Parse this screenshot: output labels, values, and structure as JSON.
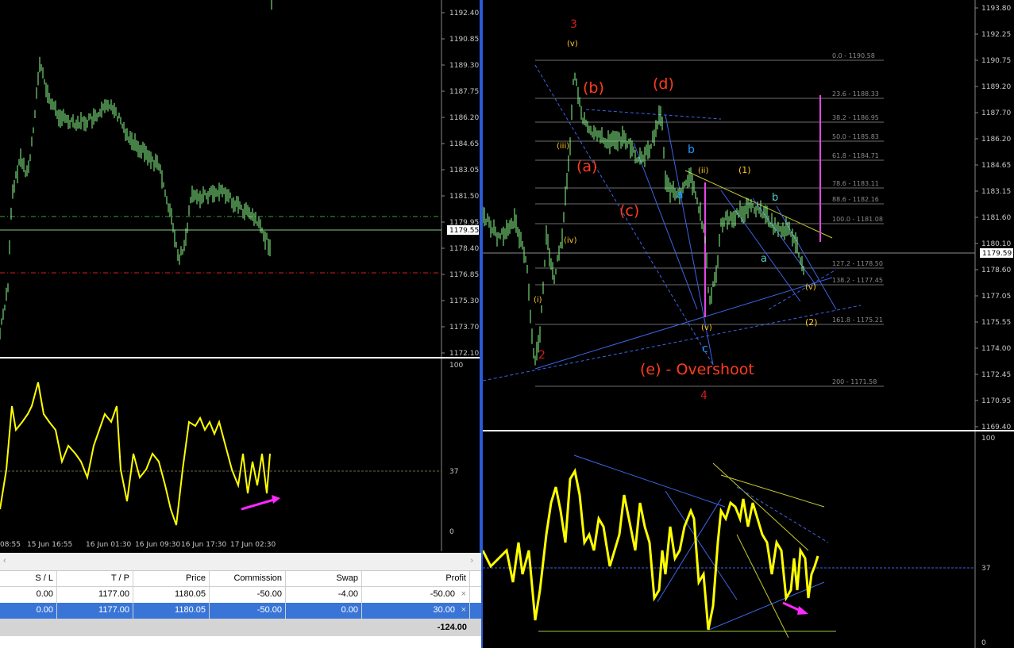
{
  "left_chart": {
    "price_labels": [
      "1192.40",
      "1190.85",
      "1189.30",
      "1187.75",
      "1186.20",
      "1184.65",
      "1183.05",
      "1181.50",
      "1179.95",
      "1178.40",
      "1176.85",
      "1175.30",
      "1173.70",
      "1172.10"
    ],
    "current_price": "1179.55",
    "indicator_labels": [
      "100",
      "37",
      "0"
    ],
    "time_labels": [
      "08:55",
      "15 Jun 16:55",
      "16 Jun 01:30",
      "16 Jun 09:30",
      "16 Jun 17:30",
      "17 Jun 02:30"
    ]
  },
  "right_chart": {
    "price_labels": [
      "1193.80",
      "1192.25",
      "1190.75",
      "1189.20",
      "1187.70",
      "1186.20",
      "1184.65",
      "1183.15",
      "1181.60",
      "1180.10",
      "1178.60",
      "1177.05",
      "1175.55",
      "1174.00",
      "1172.45",
      "1170.95",
      "1169.40"
    ],
    "current_price": "1179.59",
    "indicator_labels": [
      "100",
      "37",
      "0"
    ],
    "fib_labels": [
      "0.0 - 1190.58",
      "23.6 - 1188.33",
      "38.2 - 1186.95",
      "50.0 - 1185.83",
      "61.8 - 1184.71",
      "78.6 - 1183.11",
      "88.6 - 1182.16",
      "100.0 - 1181.08",
      "127.2 - 1178.50",
      "138.2 - 1177.45",
      "161.8 - 1175.21",
      "200 - 1171.58"
    ],
    "wave_labels": {
      "w3": "3",
      "w4": "4",
      "w2": "2",
      "a": "(a)",
      "b": "(b)",
      "c": "(c)",
      "d": "(d)",
      "e": "(e) - Overshoot",
      "sa": "a",
      "sb": "b",
      "sc": "c",
      "n1": "(1)",
      "n2": "(2)",
      "i": "(i)",
      "ii": "(ii)",
      "iii": "(iii)",
      "iv": "(iv)",
      "v": "(v)"
    },
    "colors": {
      "accent_red": "#ff3c1e",
      "cyan": "#1e9bff",
      "yellow": "#ffff00",
      "magenta": "#ff00ff",
      "green": "#7cff7c"
    }
  },
  "terminal": {
    "columns": [
      "S / L",
      "T / P",
      "Price",
      "Commission",
      "Swap",
      "Profit"
    ],
    "rows": [
      {
        "sl": "0.00",
        "tp": "1177.00",
        "price": "1180.05",
        "commission": "-50.00",
        "swap": "-4.00",
        "profit": "-50.00"
      },
      {
        "sl": "0.00",
        "tp": "1177.00",
        "price": "1180.05",
        "commission": "-50.00",
        "swap": "0.00",
        "profit": "30.00"
      }
    ],
    "total": "-124.00",
    "close_glyph": "×"
  }
}
